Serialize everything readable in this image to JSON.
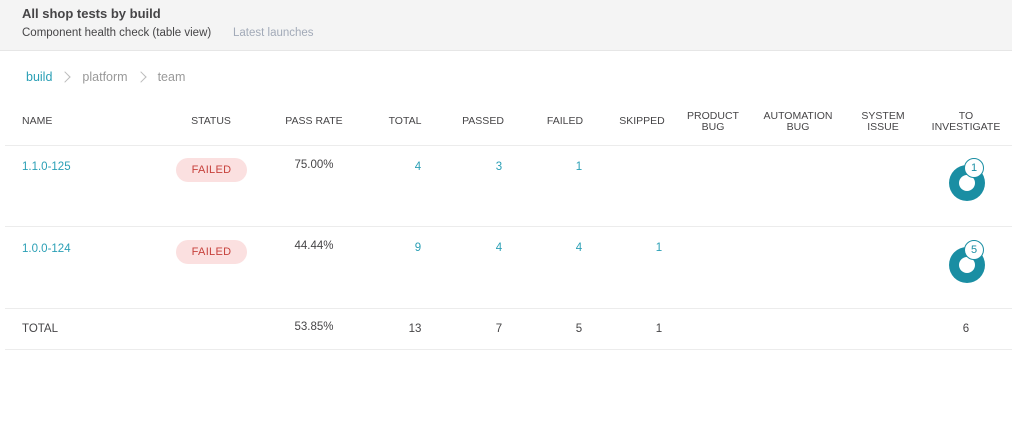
{
  "header": {
    "title": "All shop tests by build",
    "view_tab": "Component health check (table view)",
    "other_tab": "Latest launches"
  },
  "breadcrumb": [
    "build",
    "platform",
    "team"
  ],
  "columns": {
    "name": "NAME",
    "status": "STATUS",
    "pass_rate": "PASS RATE",
    "total": "TOTAL",
    "passed": "PASSED",
    "failed": "FAILED",
    "skipped": "SKIPPED",
    "product_bug": [
      "PRODUCT",
      "BUG"
    ],
    "automation_bug": [
      "AUTOMATION",
      "BUG"
    ],
    "system_issue": [
      "SYSTEM",
      "ISSUE"
    ],
    "to_investigate": [
      "TO",
      "INVESTIGATE"
    ]
  },
  "rows": [
    {
      "name": "1.1.0-125",
      "status": "FAILED",
      "pass_rate": "75.00%",
      "total": "4",
      "passed": "3",
      "failed": "1",
      "skipped": "",
      "to_investigate": "1"
    },
    {
      "name": "1.0.0-124",
      "status": "FAILED",
      "pass_rate": "44.44%",
      "total": "9",
      "passed": "4",
      "failed": "4",
      "skipped": "1",
      "to_investigate": "5"
    }
  ],
  "totals": {
    "label": "TOTAL",
    "pass_rate": "53.85%",
    "total": "13",
    "passed": "7",
    "failed": "5",
    "skipped": "1",
    "to_investigate": "6"
  },
  "colors": {
    "accent": "#2a9fb5",
    "donut": "#1a8ea3",
    "failed_badge_bg": "#fbe0e0",
    "failed_badge_text": "#c7413c"
  }
}
